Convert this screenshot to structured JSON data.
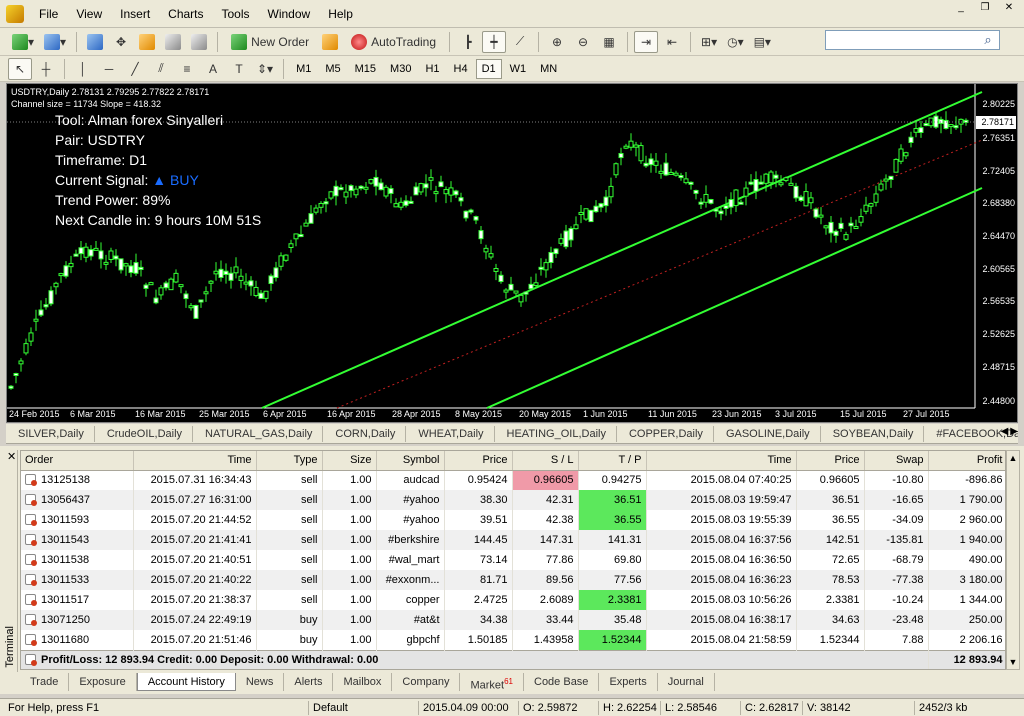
{
  "menu": [
    "File",
    "View",
    "Insert",
    "Charts",
    "Tools",
    "Window",
    "Help"
  ],
  "toolbar": {
    "new_order": "New Order",
    "auto_trading": "AutoTrading",
    "timeframes": [
      "M1",
      "M5",
      "M15",
      "M30",
      "H1",
      "H4",
      "D1",
      "W1",
      "MN"
    ],
    "active_timeframe": "D1"
  },
  "chart": {
    "header_line1": "USDTRY,Daily  2.78131 2.79295 2.77822 2.78171",
    "header_line2": "Channel size = 11734 Slope = 418.32",
    "overlay": {
      "tool": "Tool: Alman forex Sinyalleri",
      "pair": "Pair: USDTRY",
      "timeframe": "Timeframe: D1",
      "signal_prefix": "Current Signal: ",
      "signal": "▲ BUY",
      "trend": "Trend Power: 89%",
      "next_candle": "Next Candle in: 9 hours 10M 51S"
    },
    "current_price": "2.78171",
    "price_labels": [
      "2.80225",
      "2.76351",
      "2.72405",
      "2.68380",
      "2.64470",
      "2.60565",
      "2.56535",
      "2.52625",
      "2.48715",
      "2.44800"
    ],
    "time_labels": [
      "24 Feb 2015",
      "6 Mar 2015",
      "16 Mar 2015",
      "25 Mar 2015",
      "6 Apr 2015",
      "16 Apr 2015",
      "28 Apr 2015",
      "8 May 2015",
      "20 May 2015",
      "1 Jun 2015",
      "11 Jun 2015",
      "23 Jun 2015",
      "3 Jul 2015",
      "15 Jul 2015",
      "27 Jul 2015"
    ]
  },
  "symbol_tabs": [
    "SILVER,Daily",
    "CrudeOIL,Daily",
    "NATURAL_GAS,Daily",
    "CORN,Daily",
    "WHEAT,Daily",
    "HEATING_OIL,Daily",
    "COPPER,Daily",
    "GASOLINE,Daily",
    "SOYBEAN,Daily",
    "#FACEBOOK,Daily"
  ],
  "terminal": {
    "side_label": "Terminal",
    "headers": [
      "Order",
      "Time",
      "Type",
      "Size",
      "Symbol",
      "Price",
      "S / L",
      "T / P",
      "Time",
      "Price",
      "Swap",
      "Profit"
    ],
    "rows": [
      [
        "13125138",
        "2015.07.31 16:34:43",
        "sell",
        "1.00",
        "audcad",
        "0.95424",
        "0.96605",
        "0.94275",
        "2015.08.04 07:40:25",
        "0.96605",
        "-10.80",
        "-896.86"
      ],
      [
        "13056437",
        "2015.07.27 16:31:00",
        "sell",
        "1.00",
        "#yahoo",
        "38.30",
        "42.31",
        "36.51",
        "2015.08.03 19:59:47",
        "36.51",
        "-16.65",
        "1 790.00"
      ],
      [
        "13011593",
        "2015.07.20 21:44:52",
        "sell",
        "1.00",
        "#yahoo",
        "39.51",
        "42.38",
        "36.55",
        "2015.08.03 19:55:39",
        "36.55",
        "-34.09",
        "2 960.00"
      ],
      [
        "13011543",
        "2015.07.20 21:41:41",
        "sell",
        "1.00",
        "#berkshire",
        "144.45",
        "147.31",
        "141.31",
        "2015.08.04 16:37:56",
        "142.51",
        "-135.81",
        "1 940.00"
      ],
      [
        "13011538",
        "2015.07.20 21:40:51",
        "sell",
        "1.00",
        "#wal_mart",
        "73.14",
        "77.86",
        "69.80",
        "2015.08.04 16:36:50",
        "72.65",
        "-68.79",
        "490.00"
      ],
      [
        "13011533",
        "2015.07.20 21:40:22",
        "sell",
        "1.00",
        "#exxonm...",
        "81.71",
        "89.56",
        "77.56",
        "2015.08.04 16:36:23",
        "78.53",
        "-77.38",
        "3 180.00"
      ],
      [
        "13011517",
        "2015.07.20 21:38:37",
        "sell",
        "1.00",
        "copper",
        "2.4725",
        "2.6089",
        "2.3381",
        "2015.08.03 10:56:26",
        "2.3381",
        "-10.24",
        "1 344.00"
      ],
      [
        "13071250",
        "2015.07.24 22:49:19",
        "buy",
        "1.00",
        "#at&t",
        "34.38",
        "33.44",
        "35.48",
        "2015.08.04 16:38:17",
        "34.63",
        "-23.48",
        "250.00"
      ],
      [
        "13011680",
        "2015.07.20 21:51:46",
        "buy",
        "1.00",
        "gbpchf",
        "1.50185",
        "1.43958",
        "1.52344",
        "2015.08.04 21:58:59",
        "1.52344",
        "7.88",
        "2 206.16"
      ]
    ],
    "highlights": {
      "0": {
        "6": "red"
      },
      "1": {
        "7": "grn"
      },
      "2": {
        "7": "grn"
      },
      "6": {
        "7": "grn"
      },
      "8": {
        "7": "grn"
      }
    },
    "summary_text": "Profit/Loss: 12 893.94  Credit: 0.00  Deposit: 0.00  Withdrawal: 0.00",
    "summary_total": "12 893.94",
    "tabs": [
      "Trade",
      "Exposure",
      "Account History",
      "News",
      "Alerts",
      "Mailbox",
      "Company",
      "Market",
      "Code Base",
      "Experts",
      "Journal"
    ],
    "market_badge": "61",
    "active_tab": "Account History"
  },
  "status": {
    "help": "For Help, press F1",
    "profile": "Default",
    "datetime": "2015.04.09 00:00",
    "open": "O: 2.59872",
    "high": "H: 2.62254",
    "low": "L: 2.58546",
    "close": "C: 2.62817",
    "volume": "V: 38142",
    "traffic": "2452/3 kb"
  }
}
